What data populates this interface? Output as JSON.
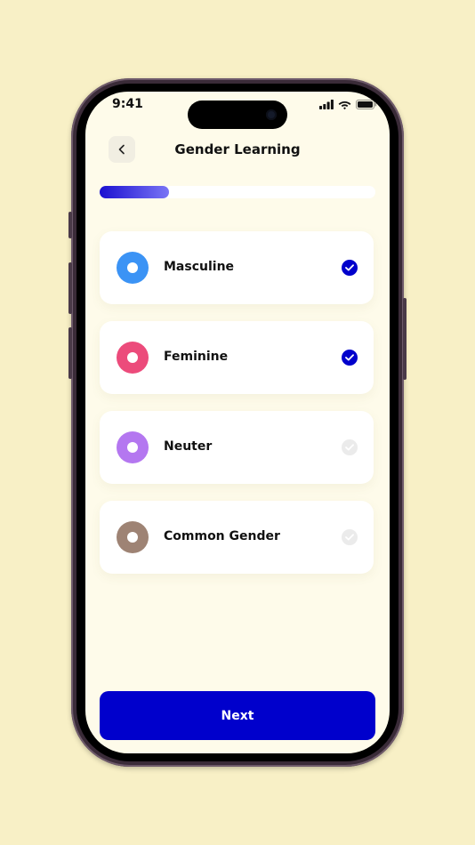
{
  "status_bar": {
    "time": "9:41"
  },
  "header": {
    "title": "Gender Learning"
  },
  "progress": {
    "fraction": 0.25
  },
  "options": [
    {
      "label": "Masculine",
      "color": "#3b93f5",
      "checked": true
    },
    {
      "label": "Feminine",
      "color": "#ec4b7b",
      "checked": true
    },
    {
      "label": "Neuter",
      "color": "#b477f0",
      "checked": false
    },
    {
      "label": "Common Gender",
      "color": "#9e8374",
      "checked": false
    }
  ],
  "actions": {
    "next_label": "Next"
  },
  "colors": {
    "accent": "#0000cc",
    "check_inactive": "#ebebeb",
    "background": "#f8f0c6"
  }
}
